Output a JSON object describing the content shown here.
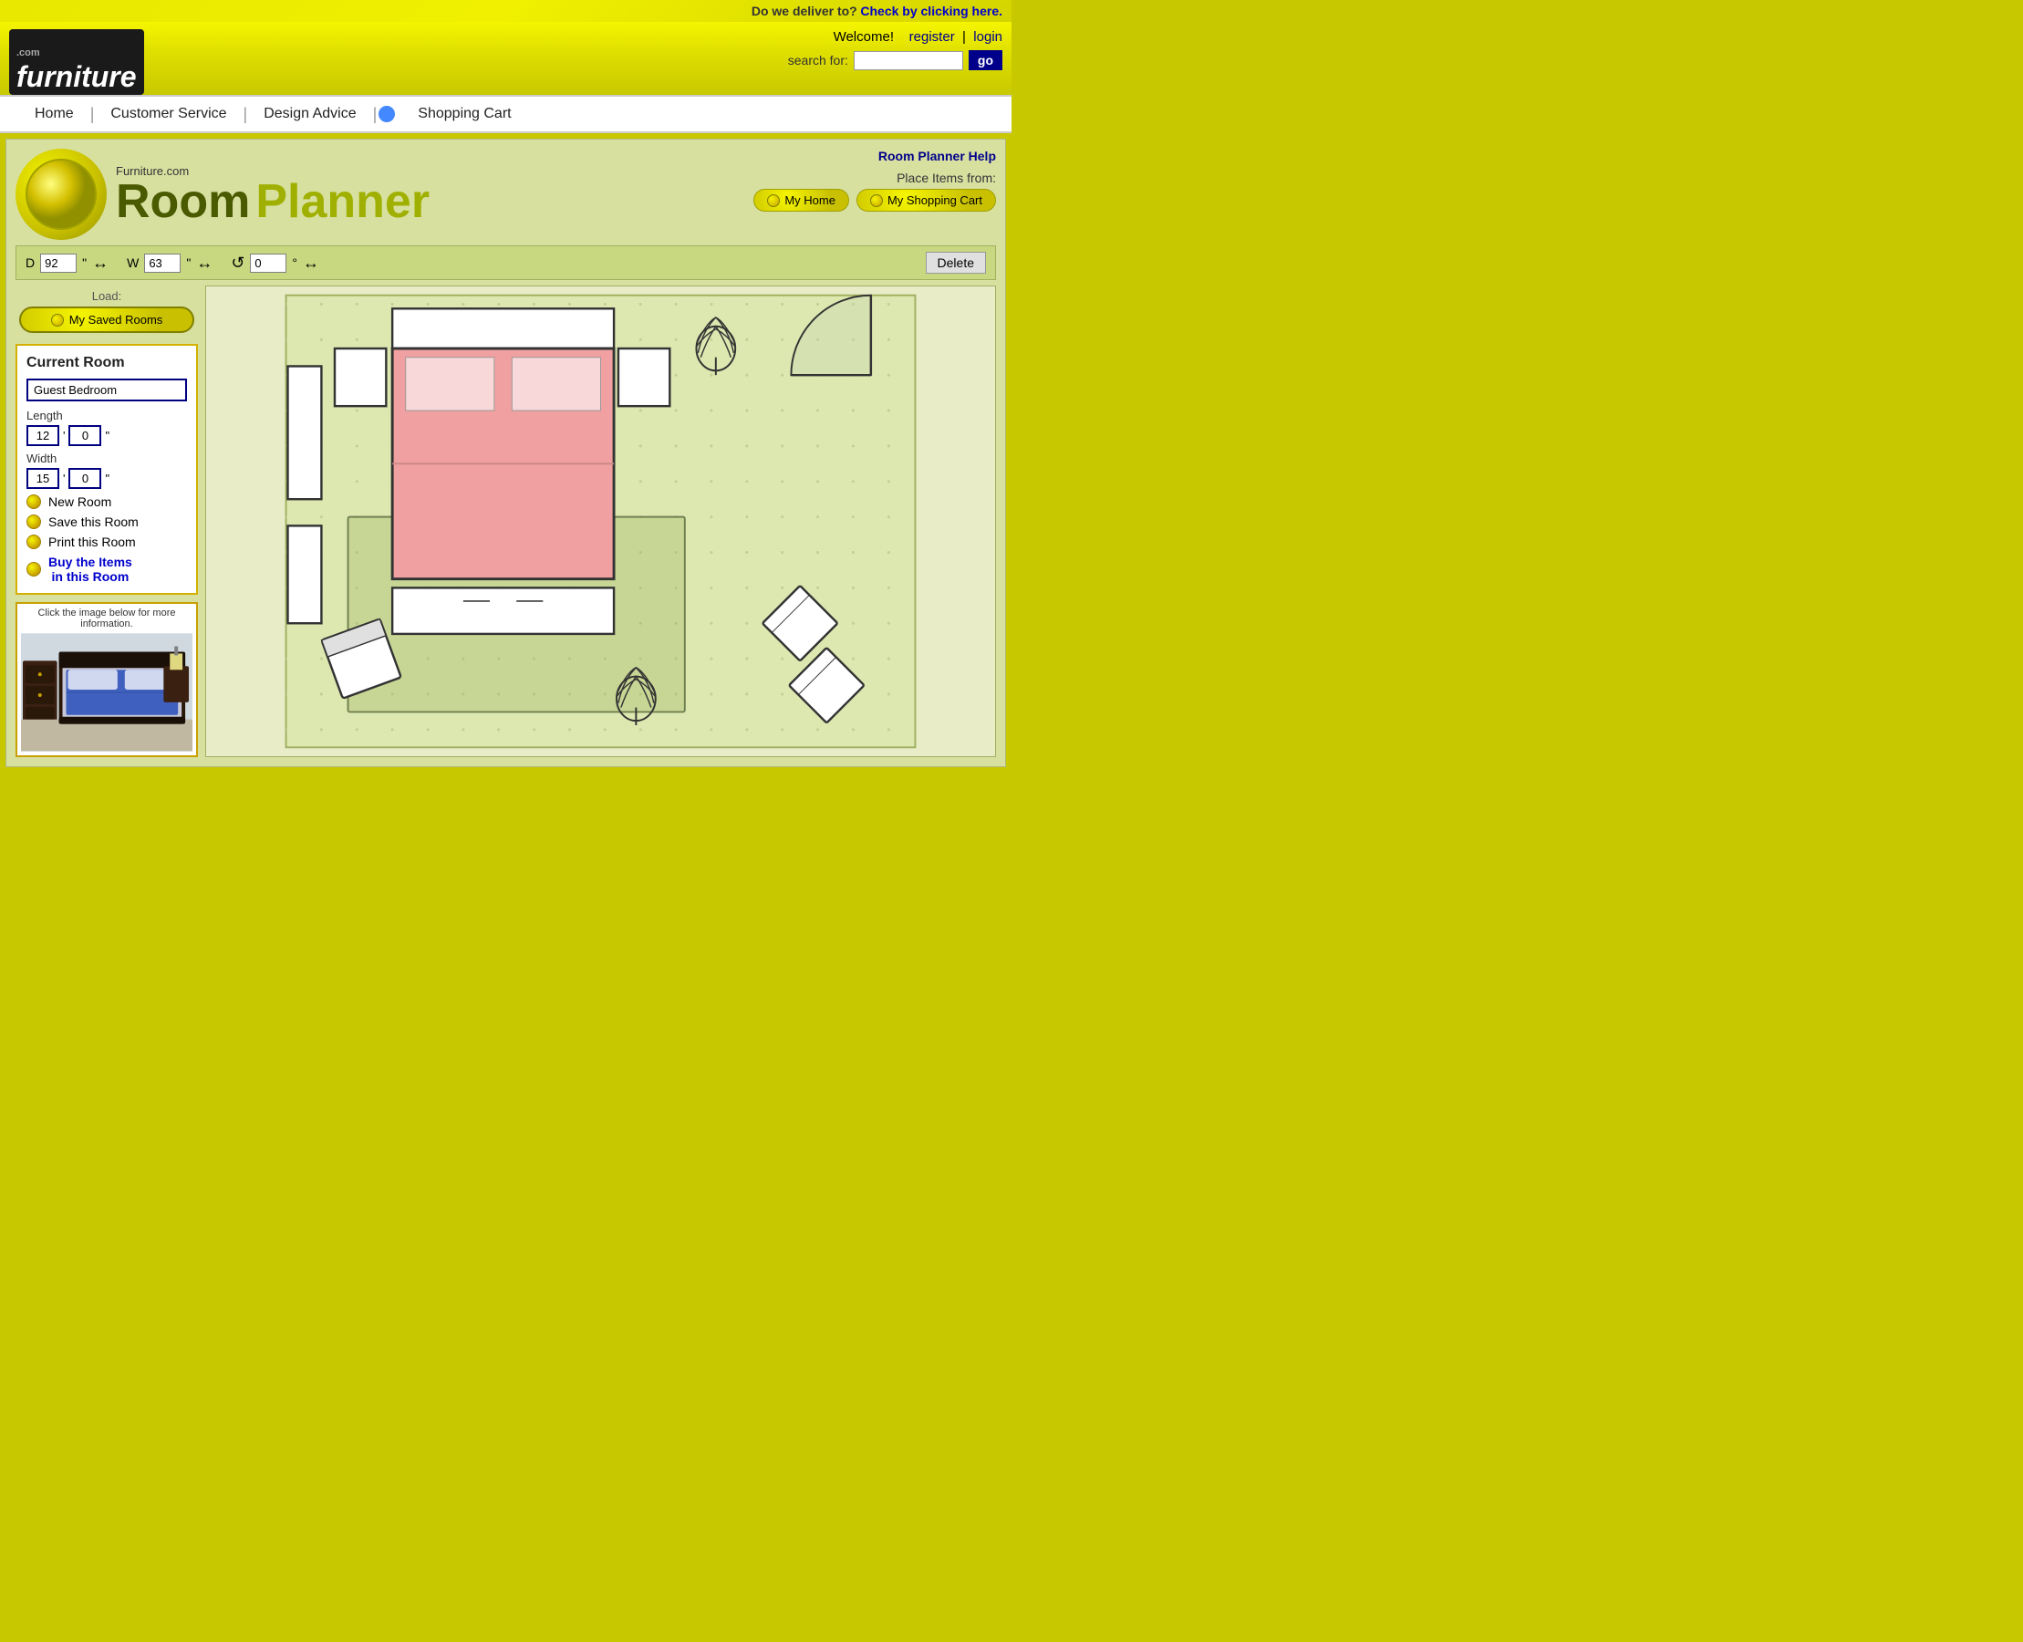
{
  "delivery_bar": {
    "text": "Do we deliver to?",
    "link_text": "Check by clicking here."
  },
  "header": {
    "logo_text": "furniture",
    "logo_dot": ".com",
    "welcome": "Welcome!",
    "register": "register",
    "pipe": "|",
    "login": "login",
    "search_label": "search for:",
    "search_placeholder": "",
    "go_button": "go"
  },
  "nav": {
    "home": "Home",
    "customer_service": "Customer Service",
    "design_advice": "Design Advice",
    "shopping_cart": "Shopping Cart"
  },
  "room_planner": {
    "furniture_com": "Furniture.com",
    "title_room": "Room",
    "title_planner": "Planner",
    "help_link": "Room Planner Help",
    "place_items_label": "Place Items from:",
    "my_home_btn": "My Home",
    "my_shopping_cart_btn": "My Shopping Cart"
  },
  "toolbar": {
    "d_label": "D",
    "d_value": "92",
    "d_unit": "\"",
    "w_label": "W",
    "w_value": "63",
    "w_unit": "\"",
    "rotate_value": "0",
    "rotate_unit": "°",
    "delete_btn": "Delete"
  },
  "left_panel": {
    "load_label": "Load:",
    "my_saved_rooms": "My Saved Rooms",
    "current_room_title": "Current Room",
    "room_name": "Guest Bedroom",
    "length_label": "Length",
    "length_feet": "12",
    "length_inches": "0",
    "length_unit": "\"",
    "width_label": "Width",
    "width_feet": "15",
    "width_inches": "0",
    "width_unit": "\"",
    "new_room": "New Room",
    "save_room": "Save this Room",
    "print_room": "Print this Room",
    "buy_items": "Buy the Items\nin this Room",
    "preview_caption": "Click the image below for more information."
  }
}
